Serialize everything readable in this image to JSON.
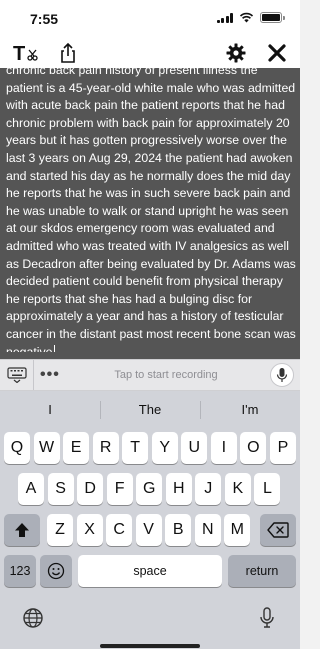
{
  "status_bar": {
    "time": "7:55"
  },
  "toolbar": {
    "left_icon": "clear-text-icon",
    "share_icon": "share-icon",
    "settings_icon": "gear-icon",
    "close_icon": "close-icon"
  },
  "transcript": {
    "text": "chronic back pain history of present illness the patient is a 45-year-old white male who was admitted with acute back pain the patient reports that he had chronic problem with back pain for approximately 20 years but it has gotten progressively worse over the last 3 years on Aug 29, 2024 the patient had awoken and started his day as he normally does the mid day he reports that he was in such severe back pain and he was unable to walk or stand upright he was seen at our skdos emergency room was evaluated and admitted who was treated with IV analgesics as well as Decadron after being evaluated by Dr. Adams was decided patient could benefit from physical therapy he reports that she has had a bulging disc for approximately a year and has a history of testicular cancer in the distant past most recent bone scan was negative"
  },
  "record_bar": {
    "hint": "Tap to start recording",
    "more": "•••"
  },
  "keyboard": {
    "suggestions": [
      "I",
      "The",
      "I'm"
    ],
    "row1": [
      "Q",
      "W",
      "E",
      "R",
      "T",
      "Y",
      "U",
      "I",
      "O",
      "P"
    ],
    "row2": [
      "A",
      "S",
      "D",
      "F",
      "G",
      "H",
      "J",
      "K",
      "L"
    ],
    "row3": [
      "Z",
      "X",
      "C",
      "V",
      "B",
      "N",
      "M"
    ],
    "numbers_label": "123",
    "space_label": "space",
    "return_label": "return"
  },
  "colors": {
    "transcript_bg": "#555555",
    "keyboard_bg": "#d1d3d9",
    "special_key": "#abafb8"
  }
}
